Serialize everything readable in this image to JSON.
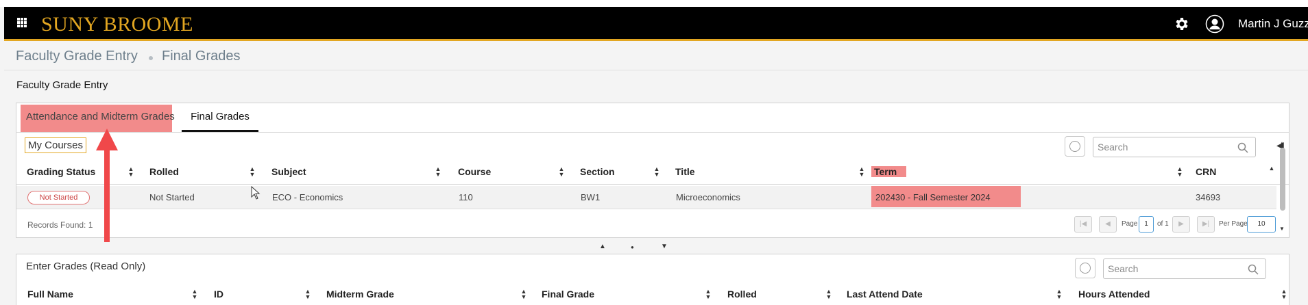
{
  "header": {
    "logo": "SUNY BROOME",
    "user_name": "Martin J Guzzi",
    "icons": [
      "apps-grid-icon",
      "gear-icon",
      "user-avatar-icon"
    ],
    "bg_color": "#000000",
    "accent_color": "#e2a621"
  },
  "breadcrumb": {
    "items": [
      "Faculty Grade Entry",
      "Final Grades"
    ]
  },
  "page_title": "Faculty Grade Entry",
  "tabs": [
    {
      "label": "Attendance and Midterm Grades",
      "active": false,
      "highlighted": true
    },
    {
      "label": "Final Grades",
      "active": true
    }
  ],
  "courses": {
    "title": "My Courses",
    "search_placeholder": "Search",
    "columns": [
      "Grading Status",
      "Rolled",
      "Subject",
      "Course",
      "Section",
      "Title",
      "Term",
      "CRN"
    ],
    "rows": [
      {
        "grading_status": "Not Started",
        "rolled": "Not Started",
        "subject": "ECO - Economics",
        "course": "110",
        "section": "BW1",
        "title": "Microeconomics",
        "term": "202430 - Fall Semester 2024",
        "crn": "34693"
      }
    ],
    "records_found": "Records Found: 1",
    "pagination": {
      "page_label": "Page",
      "page": "1",
      "of_label": "of 1",
      "per_page_label": "Per Page",
      "per_page": "10"
    }
  },
  "grades": {
    "title": "Enter Grades (Read Only)",
    "search_placeholder": "Search",
    "columns": [
      "Full Name",
      "ID",
      "Midterm Grade",
      "Final Grade",
      "Rolled",
      "Last Attend Date",
      "Hours Attended"
    ]
  },
  "highlight_color": "#f28b8b",
  "annotation_arrow_color": "#f0484a"
}
